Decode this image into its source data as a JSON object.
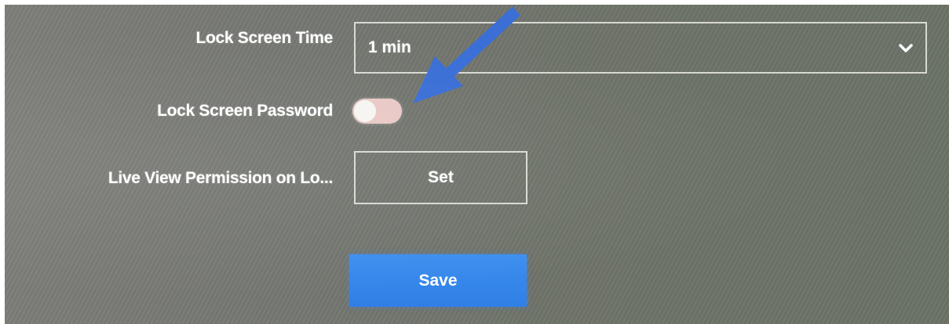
{
  "settings": {
    "lock_screen_time": {
      "label": "Lock Screen Time",
      "value": "1 min",
      "icon": "chevron-down-icon"
    },
    "lock_screen_password": {
      "label": "Lock Screen Password",
      "enabled": false
    },
    "live_view_permission": {
      "label": "Live View Permission on Lo...",
      "button_label": "Set"
    }
  },
  "actions": {
    "save_label": "Save"
  },
  "annotation": {
    "arrow_color": "#3b6fd6",
    "icon": "arrow-annotation-icon"
  },
  "colors": {
    "accent": "#2f7fe6",
    "toggle_off": "#e9c9c6"
  }
}
